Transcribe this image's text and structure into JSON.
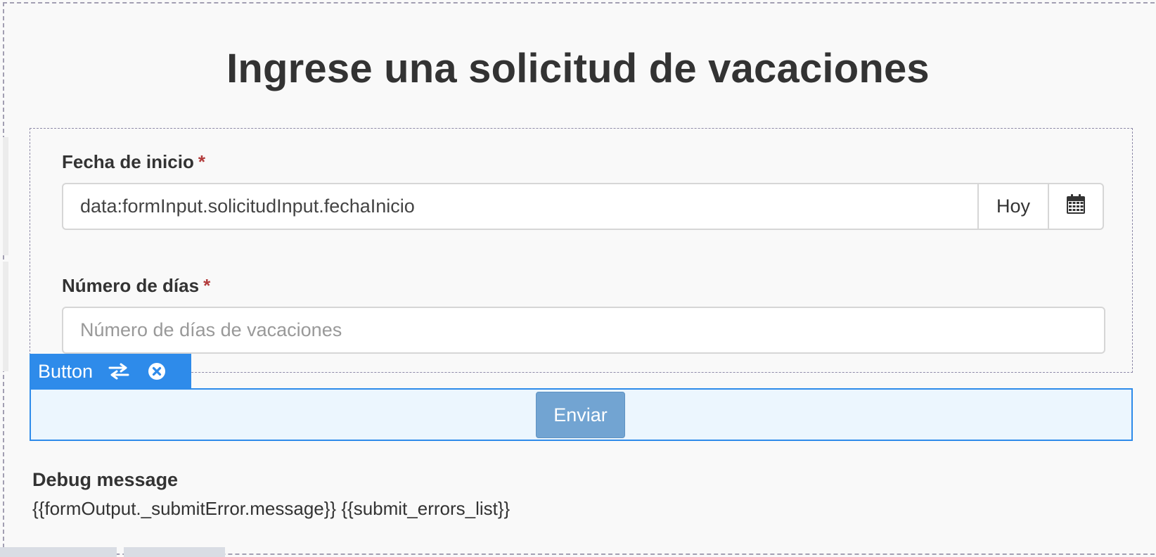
{
  "page": {
    "title": "Ingrese una solicitud de vacaciones"
  },
  "form": {
    "start_date": {
      "label": "Fecha de inicio",
      "required_mark": "*",
      "value": "data:formInput.solicitudInput.fechaInicio",
      "today_button": "Hoy",
      "calendar_icon": "calendar-icon"
    },
    "num_days": {
      "label": "Número de días",
      "required_mark": "*",
      "placeholder": "Número de días de vacaciones"
    }
  },
  "component_tag": {
    "label": "Button",
    "swap_icon": "swap-arrows-icon",
    "remove_icon": "close-circle-icon",
    "color": "#2e8bea"
  },
  "submit": {
    "label": "Enviar",
    "color": "#72a4d2"
  },
  "debug": {
    "title": "Debug message",
    "message": "{{formOutput._submitError.message}} {{submit_errors_list}}"
  }
}
